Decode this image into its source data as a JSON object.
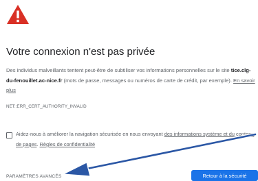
{
  "page": {
    "icon": "warning-triangle-icon",
    "title": "Votre connexion n'est pas privée",
    "description": {
      "part1": "Des individus malveillants tentent peut-être de subtiliser vos informations personnelles sur le site ",
      "domain": "tice.clg-du-fenouillet.ac-nice.fr",
      "part2": " (mots de passe, messages ou numéros de carte de crédit, par exemple). ",
      "learn_more": "En savoir plus"
    },
    "error_code": "NET::ERR_CERT_AUTHORITY_INVALID",
    "checkbox": {
      "checked": false,
      "text_before": "Aidez-nous à améliorer la navigation sécurisée en nous envoyant ",
      "link1": "des informations système et du contenu de pages",
      "text_between": ". ",
      "link2": "Règles de confidentialité"
    },
    "advanced_label": "PARAMÈTRES AVANCÉS",
    "back_button_label": "Retour à la sécurité"
  },
  "colors": {
    "warning_red": "#d93025",
    "button_blue": "#1a73e8",
    "annotation_arrow": "#2b57a5",
    "text_primary": "#202124",
    "text_secondary": "#5f6368"
  }
}
